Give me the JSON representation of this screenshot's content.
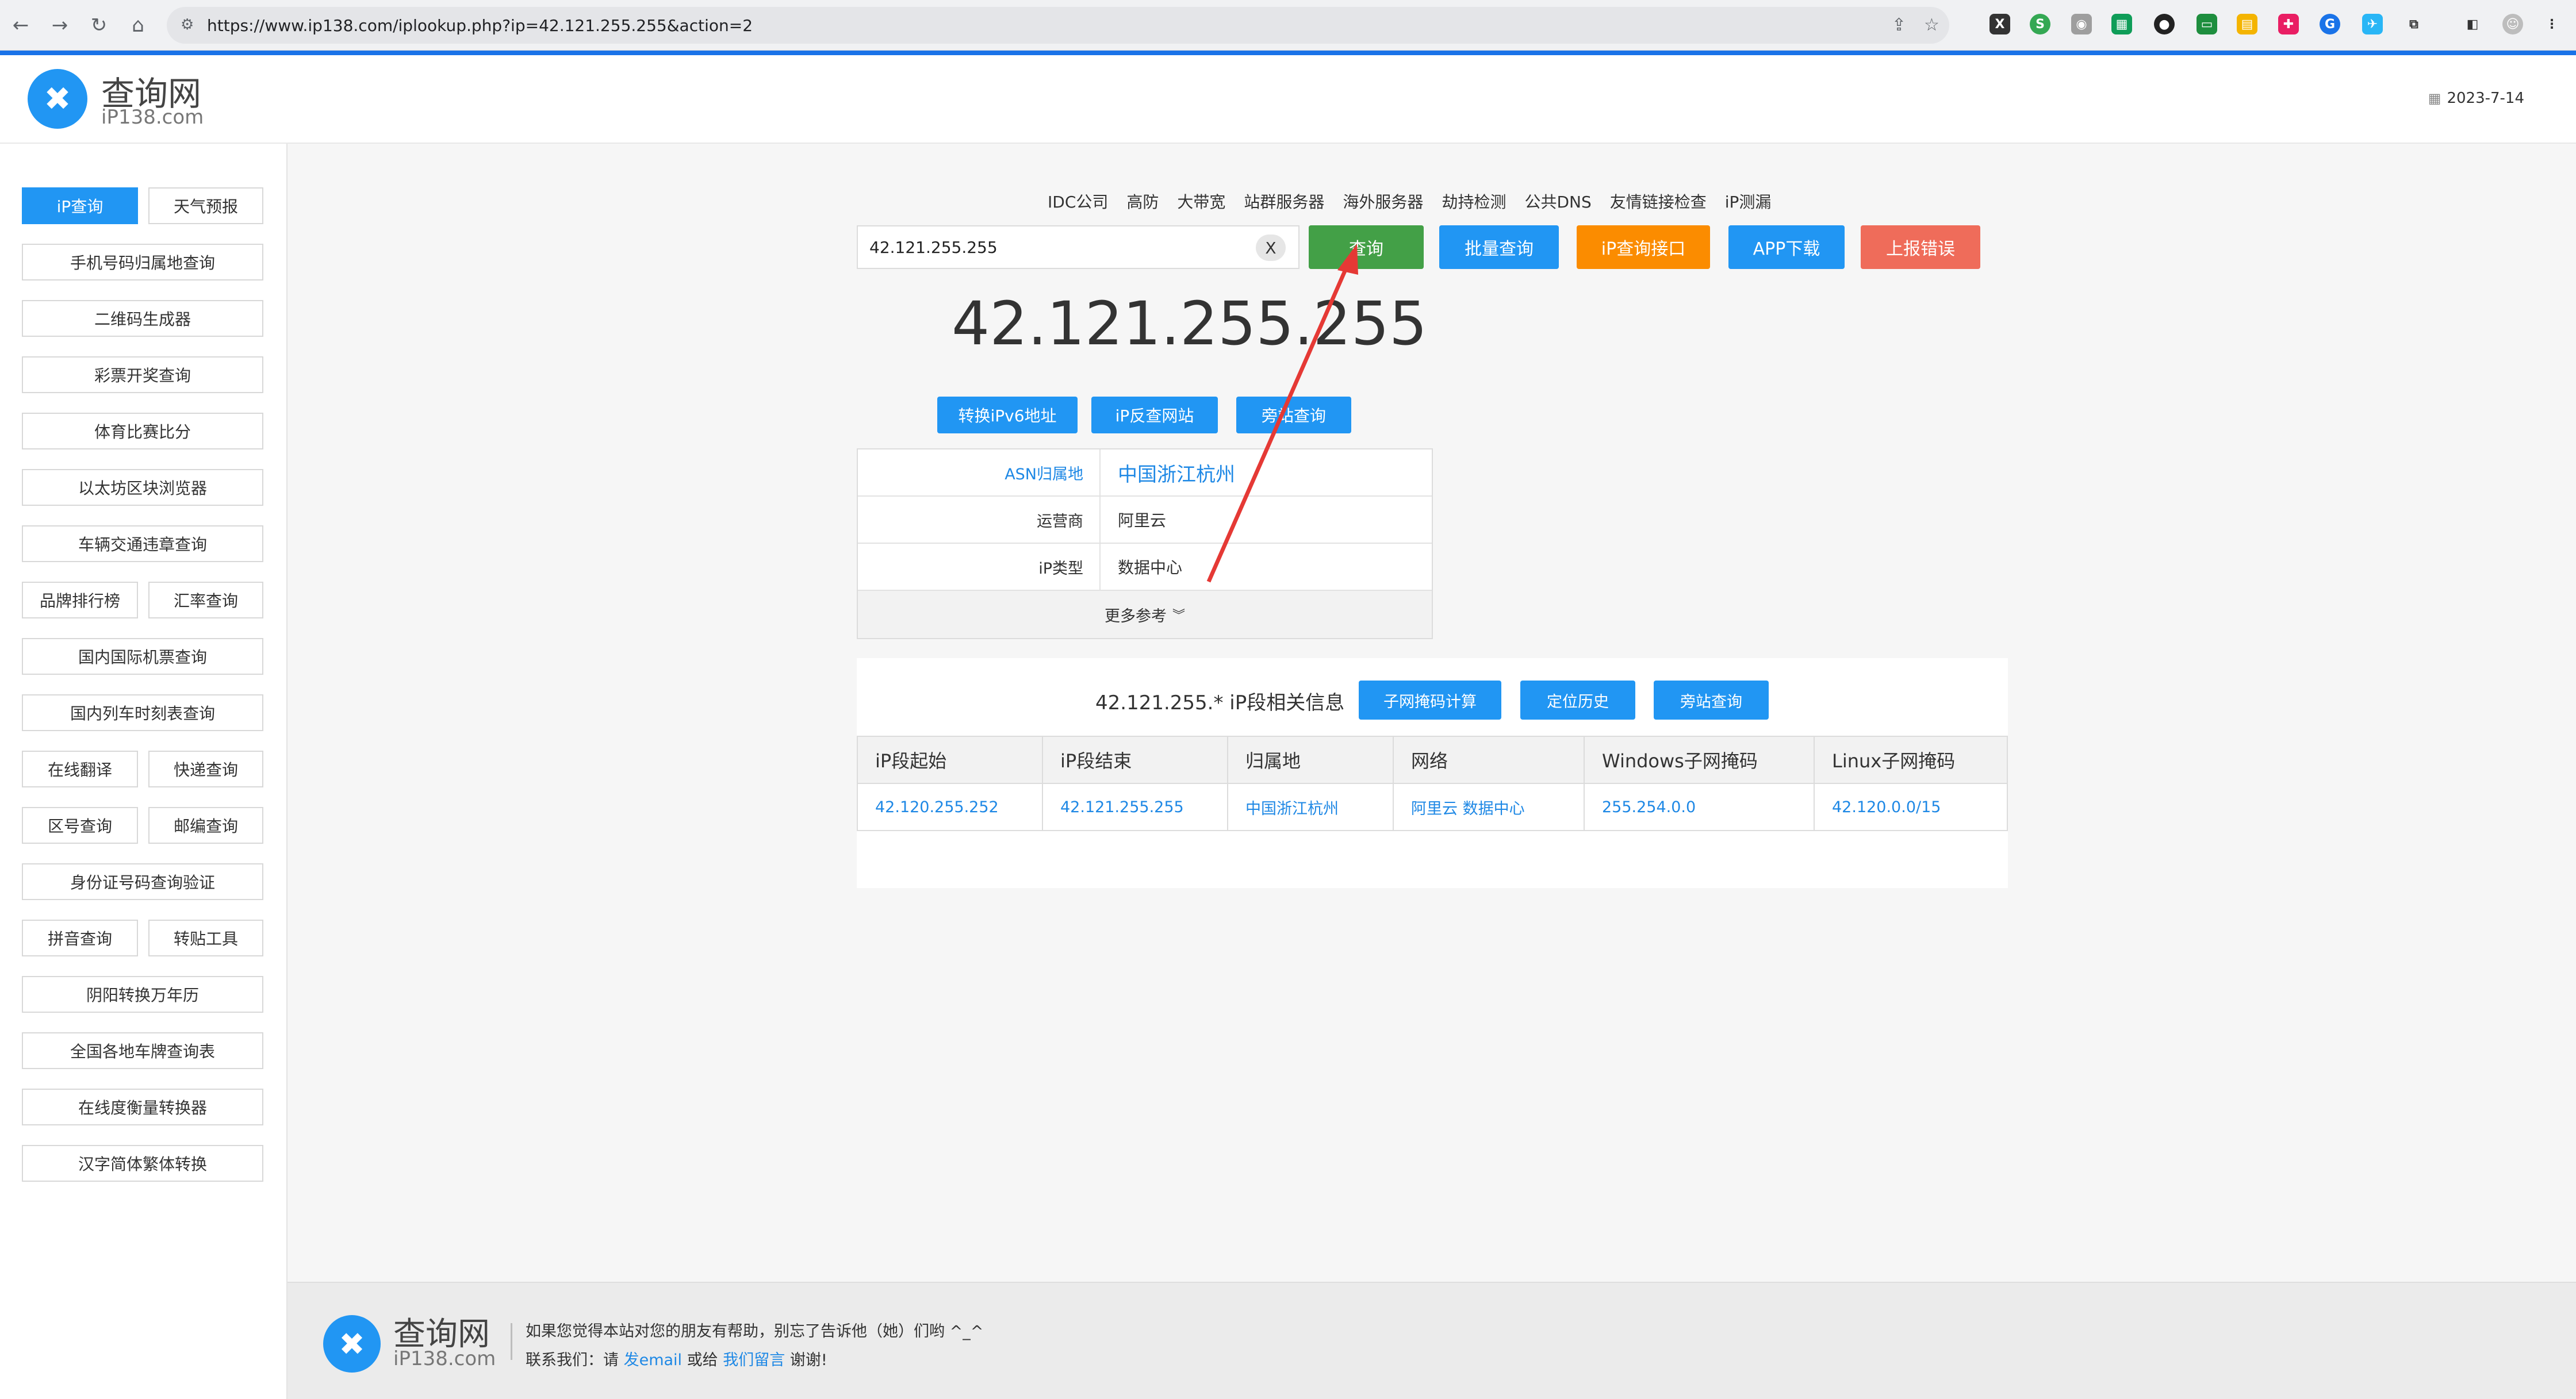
{
  "browser": {
    "url": "https://www.ip138.com/iplookup.php?ip=42.121.255.255&action=2"
  },
  "header": {
    "logo_cn": "查询网",
    "logo_en": "iP138.com",
    "date": "2023-7-14"
  },
  "sidebar": {
    "items": [
      "iP查询",
      "天气预报",
      "手机号码归属地查询",
      "二维码生成器",
      "彩票开奖查询",
      "体育比赛比分",
      "以太坊区块浏览器",
      "车辆交通违章查询",
      "品牌排行榜",
      "汇率查询",
      "国内国际机票查询",
      "国内列车时刻表查询",
      "在线翻译",
      "快递查询",
      "区号查询",
      "邮编查询",
      "身份证号码查询验证",
      "拼音查询",
      "转贴工具",
      "阴阳转换万年历",
      "全国各地车牌查询表",
      "在线度衡量转换器",
      "汉字简体繁体转换"
    ]
  },
  "toplinks": [
    "IDC公司",
    "高防",
    "大带宽",
    "站群服务器",
    "海外服务器",
    "劫持检测",
    "公共DNS",
    "友情链接检查",
    "iP测漏"
  ],
  "search": {
    "value": "42.121.255.255",
    "clear_label": "X",
    "buttons": [
      "查询",
      "批量查询",
      "iP查询接口",
      "APP下载",
      "上报错误"
    ]
  },
  "result": {
    "ip": "42.121.255.255",
    "actions": [
      "转换iPv6地址",
      "iP反查网站",
      "旁站查询"
    ],
    "rows": [
      {
        "label": "ASN归属地",
        "value": "中国浙江杭州"
      },
      {
        "label": "运营商",
        "value": "阿里云"
      },
      {
        "label": "iP类型",
        "value": "数据中心"
      }
    ],
    "more": "更多参考"
  },
  "segment": {
    "title": "42.121.255.* iP段相关信息",
    "buttons": [
      "子网掩码计算",
      "定位历史",
      "旁站查询"
    ],
    "headers": [
      "iP段起始",
      "iP段结束",
      "归属地",
      "网络",
      "Windows子网掩码",
      "Linux子网掩码"
    ],
    "row": [
      "42.120.255.252",
      "42.121.255.255",
      "中国浙江杭州",
      "阿里云 数据中心",
      "255.254.0.0",
      "42.120.0.0/15"
    ]
  },
  "footer": {
    "logo_cn": "查询网",
    "logo_en": "iP138.com",
    "line1": "如果您觉得本站对您的朋友有帮助，别忘了告诉他（她）们哟 ^_^",
    "line2_prefix": "联系我们：请",
    "line2_link1": "发email",
    "line2_mid": "或给",
    "line2_link2": "我们留言",
    "line2_suffix": "谢谢!"
  },
  "colors": {
    "blue": "#2196f3",
    "green": "#43a047",
    "orange": "#fb8c00",
    "red": "#ef6c5a",
    "annotation": "#e53935"
  }
}
